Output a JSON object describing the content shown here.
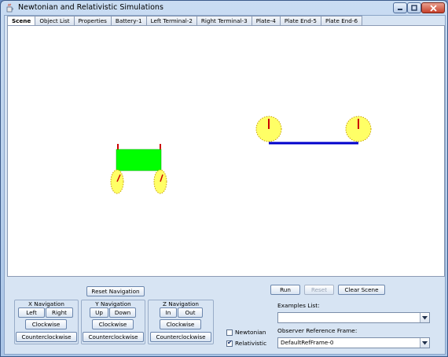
{
  "window": {
    "title": "Newtonian and Relativistic Simulations",
    "app_icon": "java-cup-icon",
    "controls": [
      "minimize-icon",
      "maximize-icon",
      "close-icon"
    ]
  },
  "tabs": [
    {
      "label": "Scene",
      "active": true
    },
    {
      "label": "Object List"
    },
    {
      "label": "Properties"
    },
    {
      "label": "Battery-1"
    },
    {
      "label": "Left Terminal-2"
    },
    {
      "label": "Right Terminal-3"
    },
    {
      "label": "Plate-4"
    },
    {
      "label": "Plate End-5"
    },
    {
      "label": "Plate End-6"
    }
  ],
  "scene": {
    "colors": {
      "battery": "#00ff00",
      "terminal": "#cc0000",
      "clock_face": "#ffff66",
      "clock_hand": "#cc0000",
      "plate": "#0000cc"
    }
  },
  "navigation": {
    "reset_label": "Reset Navigation",
    "x": {
      "title": "X Navigation",
      "a": "Left",
      "b": "Right",
      "cw": "Clockwise",
      "ccw": "Counterclockwise"
    },
    "y": {
      "title": "Y Navigation",
      "a": "Up",
      "b": "Down",
      "cw": "Clockwise",
      "ccw": "Counterclockwise"
    },
    "z": {
      "title": "Z Navigation",
      "a": "In",
      "b": "Out",
      "cw": "Clockwise",
      "ccw": "Counterclockwise"
    }
  },
  "mode": {
    "newtonian": {
      "label": "Newtonian",
      "checked": false
    },
    "relativistic": {
      "label": "Relativistic",
      "checked": true
    }
  },
  "actions": {
    "run": "Run",
    "reset": "Reset",
    "clear": "Clear Scene"
  },
  "examples": {
    "label": "Examples List:",
    "value": ""
  },
  "observer": {
    "label": "Observer Reference Frame:",
    "value": "DefaultRefFrame-0"
  }
}
